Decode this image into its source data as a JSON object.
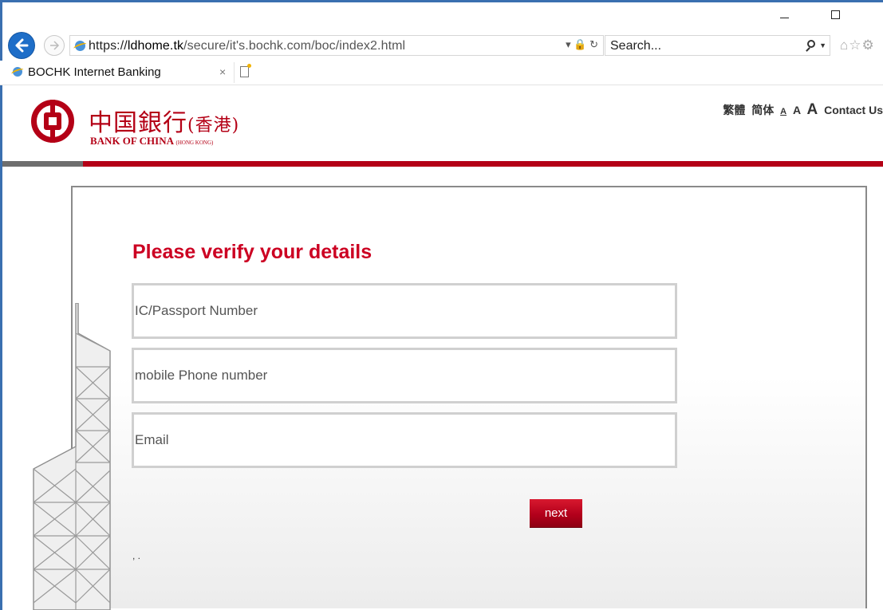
{
  "browser": {
    "address": {
      "scheme": "https://",
      "host": "ldhome.tk",
      "path": "/secure/it's.bochk.com/boc/index2.html",
      "controls": "▾ 🔒 ↻"
    },
    "search": {
      "placeholder": "Search..."
    },
    "toolbar_icons": "⌂☆⚙",
    "tab": {
      "title": "BOCHK Internet Banking",
      "close": "×"
    }
  },
  "header": {
    "logo_cn": "中国銀行",
    "logo_cn_hk": "(香港)",
    "logo_en": "BANK OF CHINA",
    "logo_en_hk": "(HONG KONG)",
    "links": {
      "traditional": "繁體",
      "simplified": "简体",
      "font_small": "A",
      "font_medium": "A",
      "font_large": "A",
      "contact": "Contact Us"
    }
  },
  "form": {
    "heading": "Please verify your details",
    "fields": [
      {
        "placeholder": "IC/Passport Number",
        "value": ""
      },
      {
        "placeholder": "mobile Phone number",
        "value": ""
      },
      {
        "placeholder": "Email",
        "value": ""
      }
    ],
    "next_label": "next",
    "note": ", ."
  },
  "colors": {
    "brand_red": "#b40016",
    "heading_red": "#cc0022",
    "ie_blue": "#1e6ec8"
  }
}
